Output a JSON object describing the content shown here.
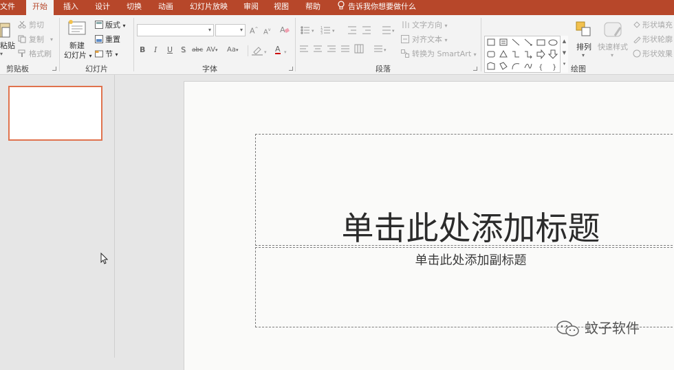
{
  "tabs": [
    {
      "label": "文件",
      "active": false
    },
    {
      "label": "开始",
      "active": true
    },
    {
      "label": "插入",
      "active": false
    },
    {
      "label": "设计",
      "active": false
    },
    {
      "label": "切换",
      "active": false
    },
    {
      "label": "动画",
      "active": false
    },
    {
      "label": "幻灯片放映",
      "active": false
    },
    {
      "label": "审阅",
      "active": false
    },
    {
      "label": "视图",
      "active": false
    },
    {
      "label": "帮助",
      "active": false
    }
  ],
  "tell_me": "告诉我你想要做什么",
  "clipboard": {
    "paste": "粘贴",
    "cut": "剪切",
    "copy": "复制",
    "format_painter": "格式刷",
    "group": "剪贴板"
  },
  "slides": {
    "new_slide_line1": "新建",
    "new_slide_line2": "幻灯片",
    "layout": "版式",
    "reset": "重置",
    "section": "节",
    "group": "幻灯片"
  },
  "font": {
    "group": "字体",
    "font_name": "",
    "font_size": "",
    "bold": "B",
    "italic": "I",
    "underline": "U",
    "shadow": "S",
    "strike": "abc",
    "spacing": "AV",
    "case": "Aa",
    "color": "A"
  },
  "paragraph": {
    "group": "段落",
    "text_direction": "文字方向",
    "align_text": "对齐文本",
    "smartart": "转换为 SmartArt"
  },
  "drawing": {
    "group": "绘图",
    "arrange": "排列",
    "quick_styles": "快速样式",
    "shape_fill": "形状填充",
    "shape_outline": "形状轮廓",
    "shape_effects": "形状效果"
  },
  "slide": {
    "title_placeholder": "单击此处添加标题",
    "subtitle_placeholder": "单击此处添加副标题"
  },
  "watermark": {
    "text": "蚊子软件"
  },
  "colors": {
    "accent": "#b7472a",
    "thumb_border": "#e0724d"
  }
}
